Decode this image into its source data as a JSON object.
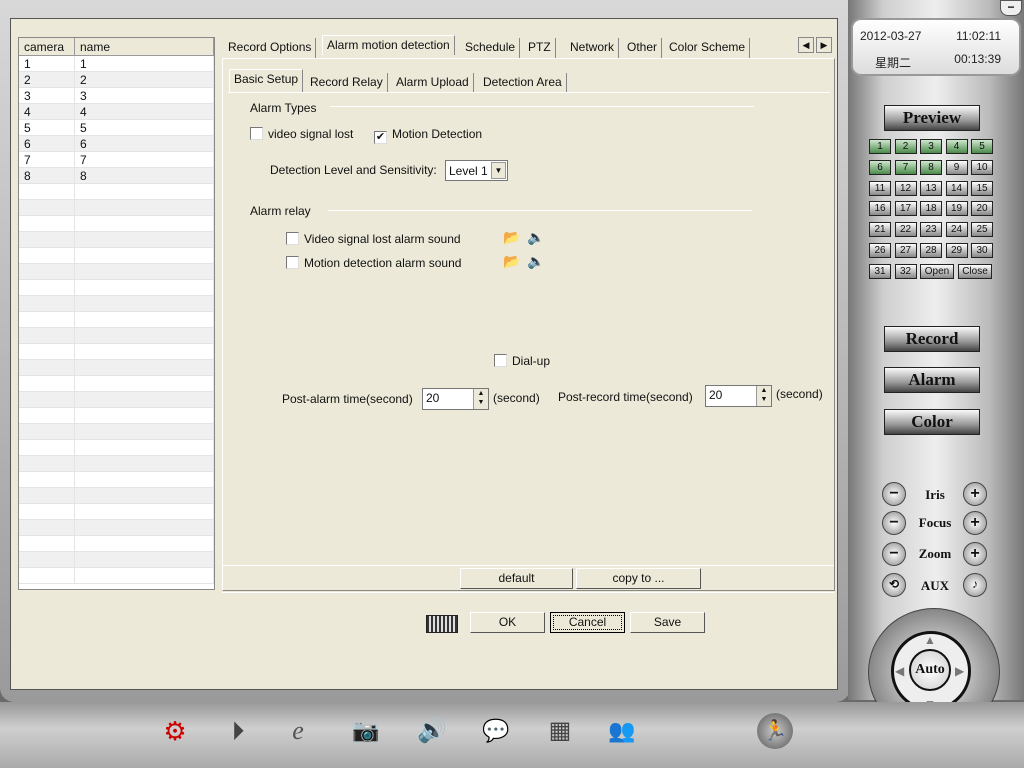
{
  "list": {
    "headers": [
      "camera",
      "name"
    ],
    "rows": [
      [
        "1",
        "1"
      ],
      [
        "2",
        "2"
      ],
      [
        "3",
        "3"
      ],
      [
        "4",
        "4"
      ],
      [
        "5",
        "5"
      ],
      [
        "6",
        "6"
      ],
      [
        "7",
        "7"
      ],
      [
        "8",
        "8"
      ]
    ]
  },
  "tabs": [
    "Record Options",
    "Alarm motion detection",
    "Schedule",
    "PTZ",
    "Network",
    "Other",
    "Color Scheme"
  ],
  "active_tab": "Alarm motion detection",
  "subtabs": [
    "Basic Setup",
    "Record Relay",
    "Alarm Upload",
    "Detection Area"
  ],
  "form": {
    "alarm_types_label": "Alarm Types",
    "video_signal_lost": {
      "label": "video signal lost",
      "checked": false
    },
    "motion_detection": {
      "label": "Motion Detection",
      "checked": true
    },
    "level_label": "Detection Level and Sensitivity:",
    "level_value": "Level 1",
    "alarm_relay_label": "Alarm relay",
    "video_lost_sound": {
      "label": "Video signal lost alarm sound",
      "checked": false
    },
    "motion_sound": {
      "label": "Motion detection alarm sound",
      "checked": false
    },
    "dialup": {
      "label": "Dial-up",
      "checked": false
    },
    "post_alarm_label": "Post-alarm time(second)",
    "post_alarm_value": "20",
    "post_record_label": "Post-record time(second)",
    "post_record_value": "20",
    "unit": "(second)"
  },
  "buttons": {
    "default": "default",
    "copy_to": "copy to ...",
    "ok": "OK",
    "cancel": "Cancel",
    "save": "Save"
  },
  "clock": {
    "date": "2012-03-27",
    "time": "11:02:11",
    "weekday": "星期二",
    "elapsed": "00:13:39"
  },
  "side": {
    "preview": "Preview",
    "channels": [
      "1",
      "2",
      "3",
      "4",
      "5",
      "6",
      "7",
      "8",
      "9",
      "10",
      "11",
      "12",
      "13",
      "14",
      "15",
      "16",
      "17",
      "18",
      "19",
      "20",
      "21",
      "22",
      "23",
      "24",
      "25",
      "26",
      "27",
      "28",
      "29",
      "30",
      "31",
      "32"
    ],
    "active_channels": 8,
    "open": "Open",
    "close": "Close",
    "record": "Record",
    "alarm": "Alarm",
    "color": "Color",
    "iris": "Iris",
    "focus": "Focus",
    "zoom": "Zoom",
    "aux": "AUX",
    "auto": "Auto"
  },
  "colors": {
    "panel": "#ece9d8",
    "active_channel": "#4a8a4a",
    "taskbar_red": "#cc0000"
  }
}
